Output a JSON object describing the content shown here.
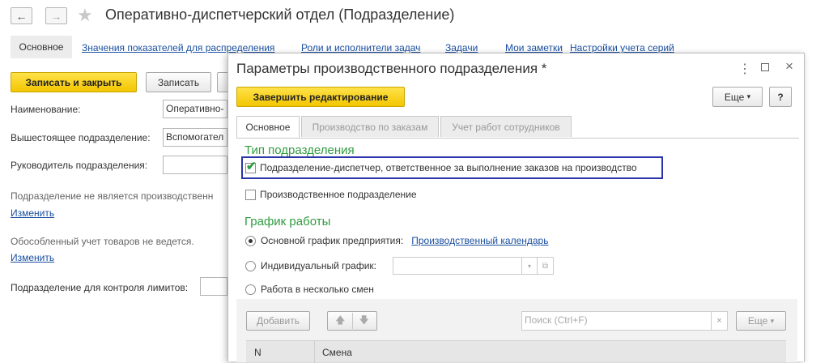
{
  "main": {
    "title": "Оперативно-диспетчерский отдел (Подразделение)",
    "tabs": [
      "Основное",
      "Значения показателей для распределения",
      "Роли и исполнители задач",
      "Задачи",
      "Мои заметки",
      "Настройки учета серий"
    ],
    "save_close": "Записать и закрыть",
    "save": "Записать",
    "fields": {
      "name_label": "Наименование:",
      "name_value": "Оперативно-",
      "parent_label": "Вышестоящее подразделение:",
      "parent_value": "Вспомогател",
      "head_label": "Руководитель подразделения:"
    },
    "not_production": "Подразделение не является производственн",
    "change1": "Изменить",
    "separate_accounting": "Обособленный учет товаров не ведется.",
    "change2": "Изменить",
    "limits_label": "Подразделение для контроля лимитов:"
  },
  "dialog": {
    "title": "Параметры производственного подразделения *",
    "finish_edit": "Завершить редактирование",
    "more": "Еще",
    "help": "?",
    "tabs": [
      "Основное",
      "Производство по заказам",
      "Учет работ сотрудников"
    ],
    "type_section": "Тип подразделения",
    "dispatcher_checkbox": "Подразделение-диспетчер, ответственное за выполнение заказов на производство",
    "dispatcher_checked": true,
    "production_checkbox": "Производственное подразделение",
    "production_checked": false,
    "schedule_section": "График работы",
    "radio_main": "Основной график предприятия:",
    "production_calendar": "Производственный календарь",
    "radio_individual": "Индивидуальный график:",
    "radio_shifts": "Работа в несколько смен",
    "add_button": "Добавить",
    "search_placeholder": "Поиск (Ctrl+F)",
    "more2": "Еще",
    "table_headers": [
      "N",
      "Смена"
    ]
  }
}
